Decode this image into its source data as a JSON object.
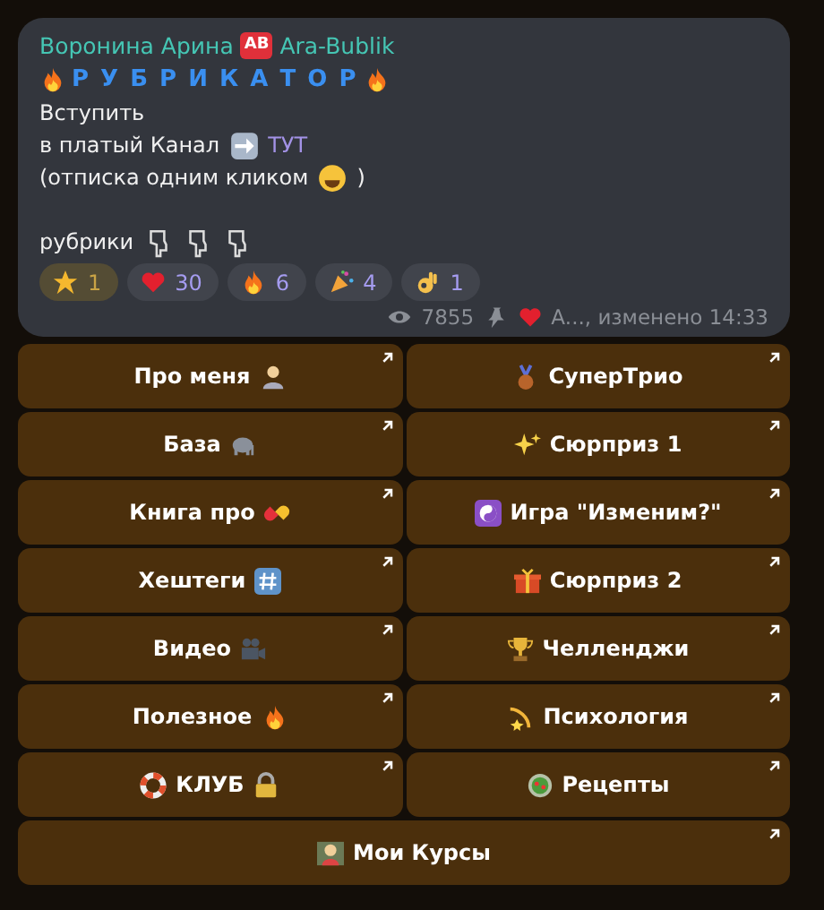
{
  "post": {
    "author": "Воронина Арина",
    "badge": "AB",
    "signature": "Ara-Bublik",
    "title": "Р У Б Р И К А Т О Р",
    "paragraphs": [
      [
        [
          {
            "kind": "text",
            "text": "Вступить"
          }
        ],
        [
          {
            "kind": "text",
            "text": "в платый Канал"
          },
          {
            "kind": "emoji"
          },
          {
            "kind": "link",
            "text": "ТУТ"
          }
        ],
        [
          {
            "kind": "text",
            "text": "(отписка одним кликом"
          },
          {
            "kind": "emoji"
          },
          {
            "kind": "text",
            "text": ")"
          }
        ]
      ],
      [
        [
          {
            "kind": "text",
            "text": "рубрики"
          },
          {
            "kind": "emoji"
          },
          {
            "kind": "emoji"
          },
          {
            "kind": "emoji"
          }
        ]
      ]
    ],
    "reactions": [
      {
        "count": "1",
        "selected": true
      },
      {
        "count": "30",
        "selected": false
      },
      {
        "count": "6",
        "selected": false
      },
      {
        "count": "4",
        "selected": false
      },
      {
        "count": "1",
        "selected": false
      }
    ],
    "views": "7855",
    "pinned": true,
    "meta": "А..., изменено 14:33"
  },
  "buttons": [
    {
      "label": "Про меня"
    },
    {
      "label": "СуперТрио"
    },
    {
      "label": "База"
    },
    {
      "label": "Сюрприз 1"
    },
    {
      "label": "Книга про"
    },
    {
      "label": "Игра \"Изменим?\""
    },
    {
      "label": "Хештеги"
    },
    {
      "label": "Сюрприз 2"
    },
    {
      "label": "Видео"
    },
    {
      "label": "Челленджи"
    },
    {
      "label": "Полезное"
    },
    {
      "label": "Психология"
    },
    {
      "label": "КЛУБ"
    },
    {
      "label": "Рецепты"
    },
    {
      "label": "Мои Курсы"
    }
  ]
}
